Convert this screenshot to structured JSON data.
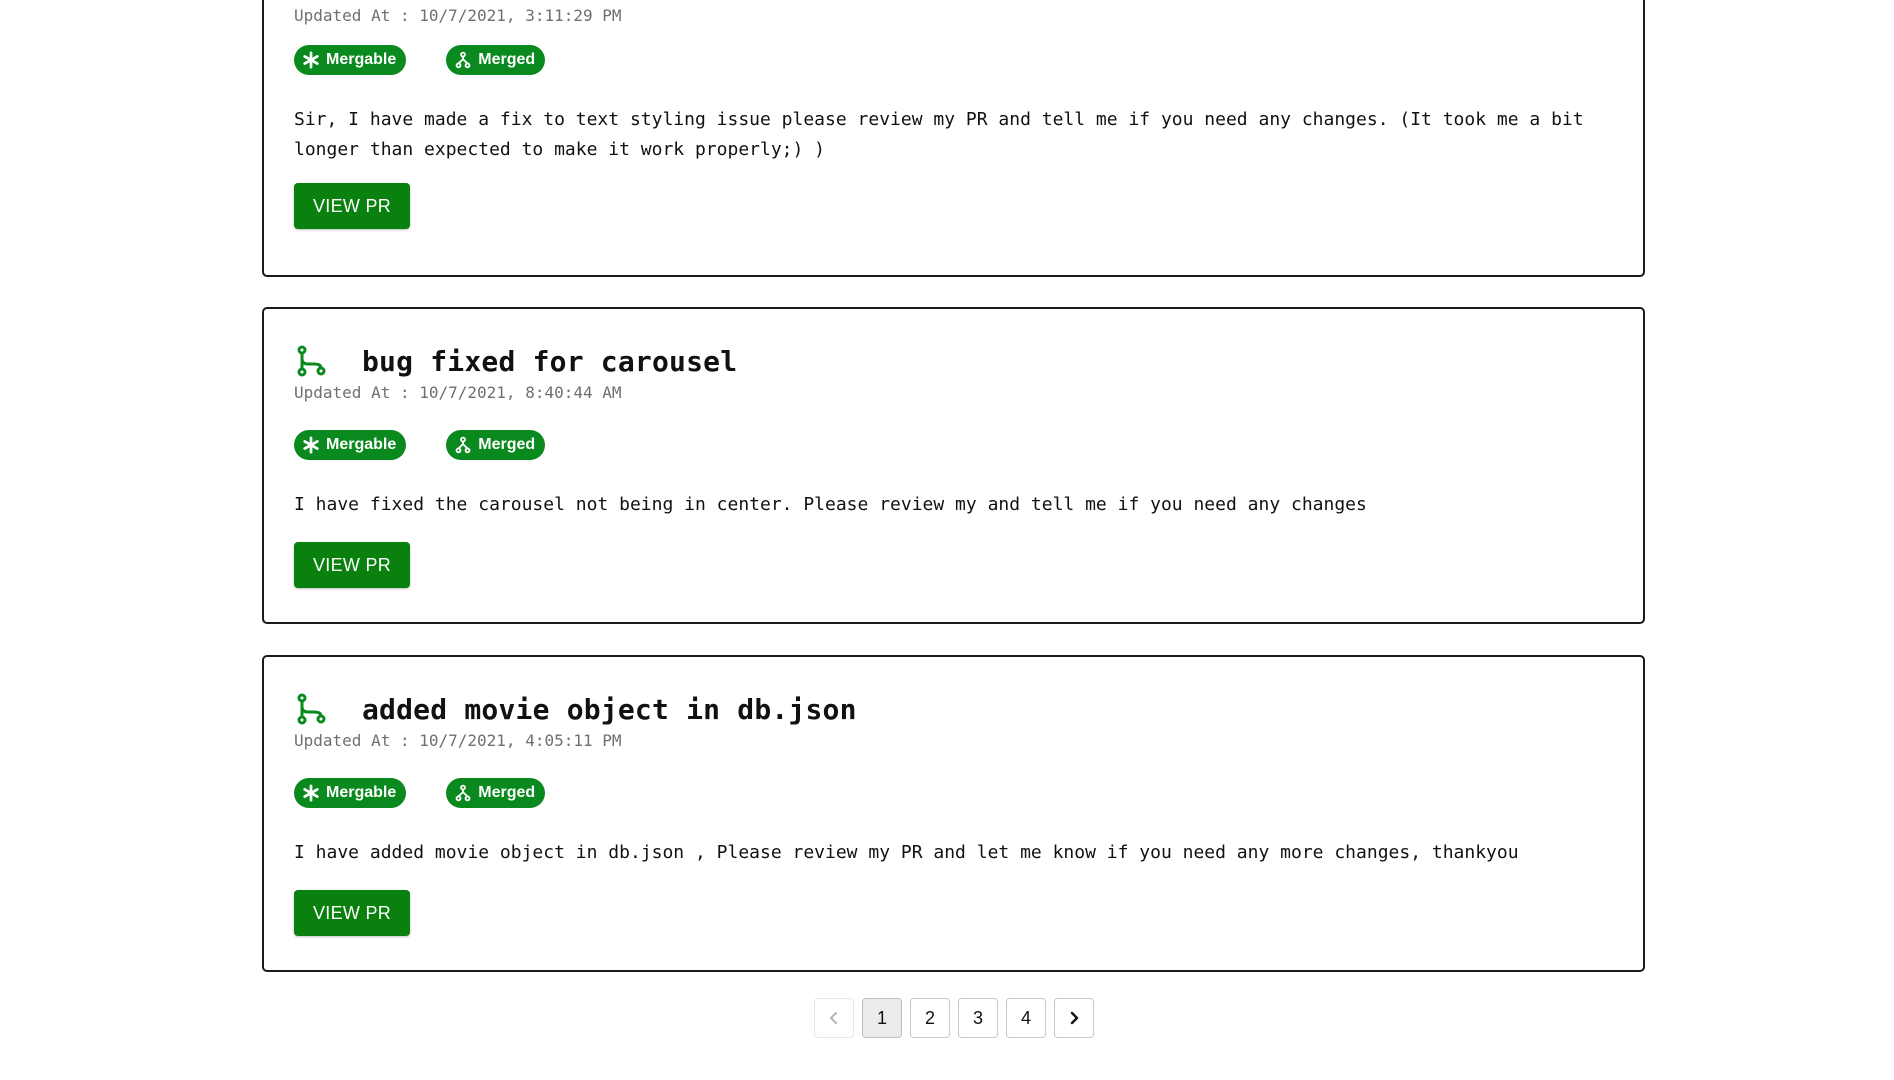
{
  "colors": {
    "accent_green": "#0a8a1e",
    "button_green": "#0a800f",
    "muted_text": "#6f6f6f"
  },
  "icons": {
    "pr_icon": "git-pull-request-icon",
    "mergable_icon": "asterisk-icon",
    "merged_icon": "git-merge-icon",
    "prev_icon": "chevron-left-icon",
    "next_icon": "chevron-right-icon"
  },
  "pull_requests": [
    {
      "title": "",
      "updated": "Updated At : 10/7/2021, 3:11:29 PM",
      "badges": [
        "Mergable",
        "Merged"
      ],
      "description": "Sir, I have made a fix to text styling issue please review my PR and tell me if you need any changes. (It took me a bit longer than expected to make it work properly;) )",
      "button_label": "VIEW PR"
    },
    {
      "title": "bug fixed for carousel",
      "updated": "Updated At : 10/7/2021, 8:40:44 AM",
      "badges": [
        "Mergable",
        "Merged"
      ],
      "description": "I have fixed the carousel not being in center. Please review my and tell me if you need any changes",
      "button_label": "VIEW PR"
    },
    {
      "title": "added movie object in db.json",
      "updated": "Updated At : 10/7/2021, 4:05:11 PM",
      "badges": [
        "Mergable",
        "Merged"
      ],
      "description": "I have added movie object in db.json , Please review my PR and let me know if you need any more changes, thankyou",
      "button_label": "VIEW PR"
    }
  ],
  "pagination": {
    "pages": [
      "1",
      "2",
      "3",
      "4"
    ],
    "current": "1",
    "prev_disabled": true
  }
}
